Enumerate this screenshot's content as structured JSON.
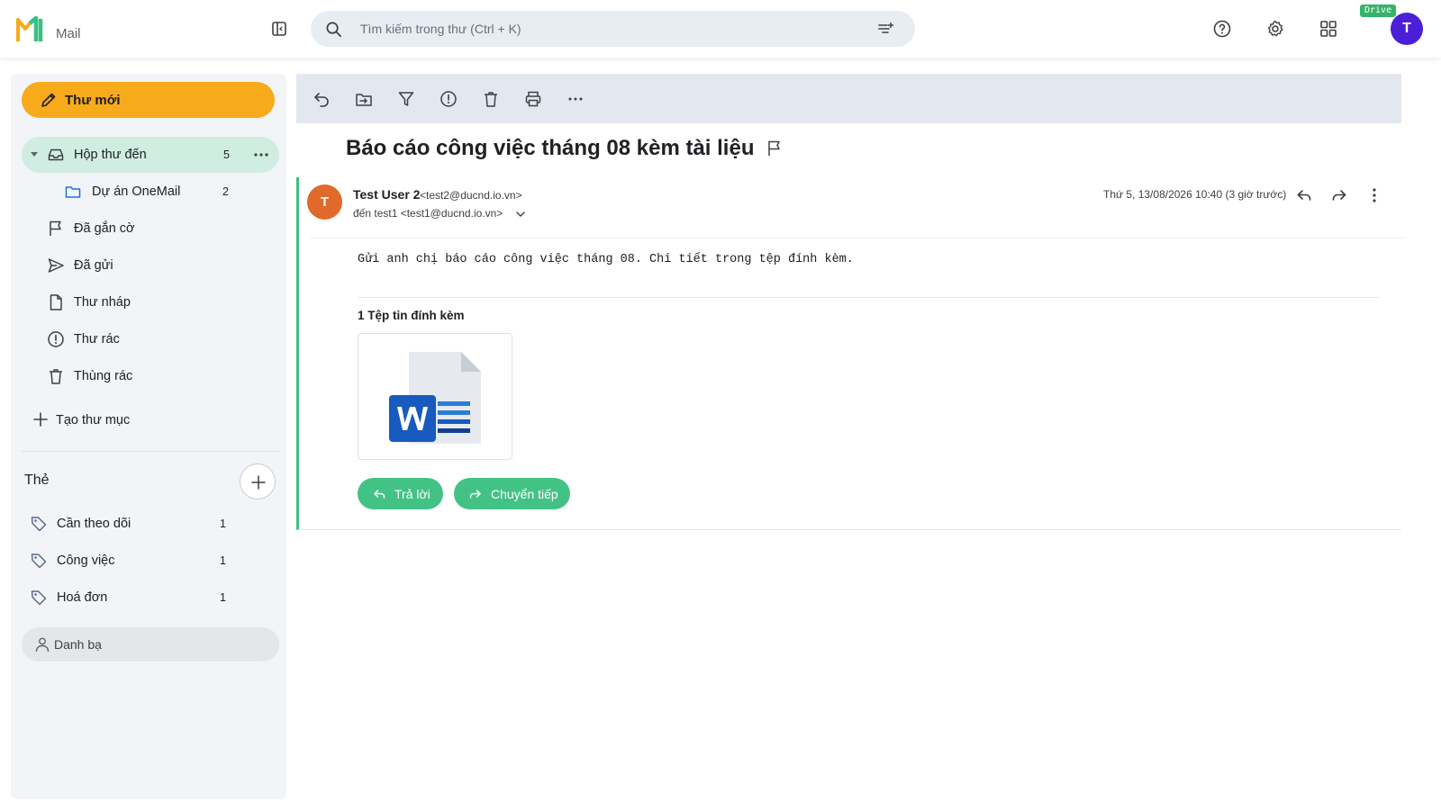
{
  "app": {
    "name": "Mail"
  },
  "search": {
    "placeholder": "Tìm kiếm trong thư (Ctrl + K)"
  },
  "header": {
    "drive_badge": "Drive",
    "avatar_initial": "T"
  },
  "sidebar": {
    "compose_label": "Thư mới",
    "folders": [
      {
        "label": "Hộp thư đến",
        "count": "5",
        "icon": "inbox-icon",
        "active": true
      },
      {
        "label": "Dự án OneMail",
        "count": "2",
        "icon": "folder-icon"
      },
      {
        "label": "Đã gắn cờ",
        "count": "",
        "icon": "flag-icon"
      },
      {
        "label": "Đã gửi",
        "count": "",
        "icon": "send-icon"
      },
      {
        "label": "Thư nháp",
        "count": "",
        "icon": "draft-icon"
      },
      {
        "label": "Thư rác",
        "count": "",
        "icon": "spam-icon"
      },
      {
        "label": "Thùng rác",
        "count": "",
        "icon": "trash-icon"
      }
    ],
    "create_folder_label": "Tạo thư mục",
    "tags_title": "Thẻ",
    "tags": [
      {
        "label": "Cần theo dõi",
        "count": "1"
      },
      {
        "label": "Công việc",
        "count": "1"
      },
      {
        "label": "Hoá đơn",
        "count": "1"
      }
    ],
    "contacts_label": "Danh bạ"
  },
  "email": {
    "subject": "Báo cáo công việc tháng 08 kèm tài liệu",
    "sender_initial": "T",
    "sender_name": "Test User 2",
    "sender_email": "<test2@ducnd.io.vn>",
    "recipient": "đến test1 <test1@ducnd.io.vn>",
    "date": "Thứ 5, 13/08/2026 10:40 (3 giờ trước)",
    "body": "Gửi anh chị báo cáo công việc tháng 08. Chi tiết trong tệp đính kèm.",
    "attachments_title": "1 Tệp tin đính kèm",
    "reply_label": "Trả lời",
    "forward_label": "Chuyển tiếp"
  },
  "colors": {
    "accent_green": "#3ac083",
    "compose_yellow": "#f8ab1a",
    "active_folder_bg": "#cfeee1",
    "avatar_purple": "#4b1fd8",
    "sender_avatar_orange": "#e0692b",
    "word_blue": "#185abd"
  }
}
